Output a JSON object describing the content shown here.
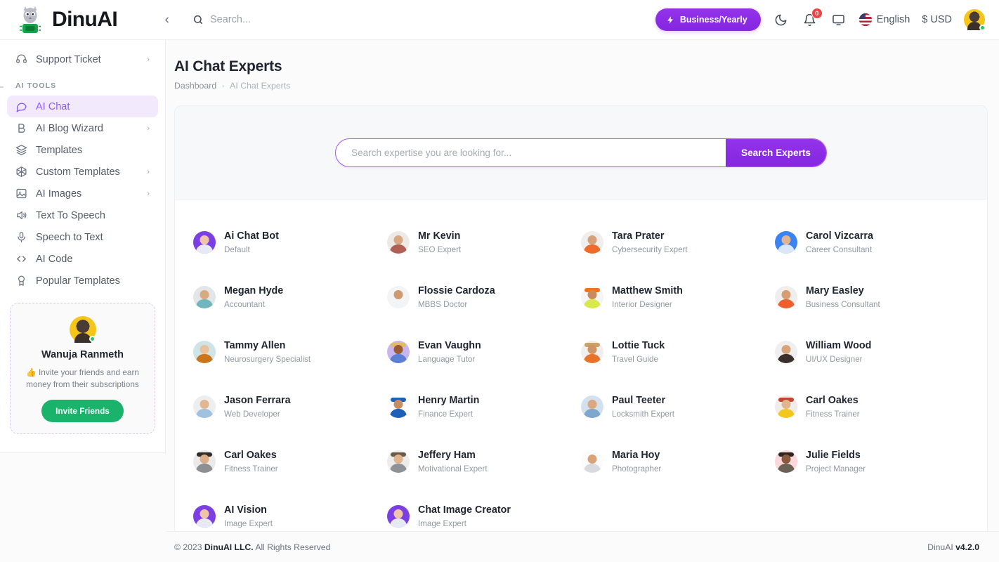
{
  "brand": {
    "name": "DinuAI",
    "logo_icon": "owl-chip-logo"
  },
  "topbar": {
    "collapse_icon": "chevron-left-icon",
    "search_placeholder": "Search...",
    "search_icon": "search-icon",
    "plan_badge": {
      "label": "Business/Yearly",
      "icon": "lightning-bolt-icon",
      "color": "#9333ea"
    },
    "theme_toggle_icon": "moon-icon",
    "notifications": {
      "icon": "bell-icon",
      "count": "0",
      "badge_color": "#ef4444"
    },
    "screen_icon": "monitor-icon",
    "language": {
      "label": "English",
      "flag_icon": "us-flag-icon"
    },
    "currency": {
      "label": "$ USD"
    },
    "avatar": {
      "name": "user-avatar",
      "status": "online",
      "status_color": "#22c55e"
    }
  },
  "sidebar": {
    "top_items": [
      {
        "label": "Support Ticket",
        "icon": "support-ticket-icon",
        "chevron": true,
        "active": false
      }
    ],
    "section_label": "AI TOOLS",
    "items": [
      {
        "label": "AI Chat",
        "icon": "chat-bubble-icon",
        "chevron": false,
        "active": true
      },
      {
        "label": "AI Blog Wizard",
        "icon": "blog-b-icon",
        "chevron": true,
        "active": false
      },
      {
        "label": "Templates",
        "icon": "layers-icon",
        "chevron": false,
        "active": false
      },
      {
        "label": "Custom Templates",
        "icon": "cube-icon",
        "chevron": true,
        "active": false
      },
      {
        "label": "AI Images",
        "icon": "image-icon",
        "chevron": true,
        "active": false
      },
      {
        "label": "Text To Speech",
        "icon": "speaker-icon",
        "chevron": false,
        "active": false
      },
      {
        "label": "Speech to Text",
        "icon": "microphone-icon",
        "chevron": false,
        "active": false
      },
      {
        "label": "AI Code",
        "icon": "code-brackets-icon",
        "chevron": false,
        "active": false
      },
      {
        "label": "Popular Templates",
        "icon": "award-icon",
        "chevron": false,
        "active": false
      }
    ],
    "invite_card": {
      "name": "Wanuja Ranmeth",
      "description": "👍 Invite your friends and earn money from their subscriptions",
      "button_label": "Invite Friends",
      "button_color": "#19b36b",
      "avatar_icon": "user-avatar"
    }
  },
  "page": {
    "title": "AI Chat Experts",
    "breadcrumb": {
      "root": "Dashboard",
      "separator": "›",
      "current": "AI Chat Experts"
    }
  },
  "search": {
    "placeholder": "Search expertise you are looking for...",
    "value": "",
    "button_label": "Search Experts",
    "accent_color": "#a855f7"
  },
  "experts": [
    {
      "name": "Ai Chat Bot",
      "role": "Default",
      "bg": "#7b3fe4",
      "head": "#f0c4a8",
      "torso": "#e7eaf5",
      "hat": ""
    },
    {
      "name": "Mr Kevin",
      "role": "SEO Expert",
      "bg": "#ece9e6",
      "head": "#d8a882",
      "torso": "#b05f54",
      "hat": ""
    },
    {
      "name": "Tara Prater",
      "role": "Cybersecurity Expert",
      "bg": "#f0eeec",
      "head": "#d6a07a",
      "torso": "#ef6b2a",
      "hat": ""
    },
    {
      "name": "Carol Vizcarra",
      "role": "Career Consultant",
      "bg": "#3b82f6",
      "head": "#e0b48e",
      "torso": "#dbe7f7",
      "hat": ""
    },
    {
      "name": "Megan Hyde",
      "role": "Accountant",
      "bg": "#e3e6e8",
      "head": "#d9a97f",
      "torso": "#6fb7bd",
      "hat": ""
    },
    {
      "name": "Flossie Cardoza",
      "role": "MBBS Doctor",
      "bg": "#f4f4f5",
      "head": "#cf9a70",
      "torso": "#f2f4f7",
      "hat": ""
    },
    {
      "name": "Matthew Smith",
      "role": "Interior Designer",
      "bg": "#f5f5f5",
      "head": "#c98a5c",
      "torso": "#d9e84a",
      "hat": "#f97316"
    },
    {
      "name": "Mary Easley",
      "role": "Business Consultant",
      "bg": "#f0eeed",
      "head": "#d79c6f",
      "torso": "#ef5f2b",
      "hat": ""
    },
    {
      "name": "Tammy Allen",
      "role": "Neurosurgery Specialist",
      "bg": "#cfe4e7",
      "head": "#e8c19b",
      "torso": "#c8751c",
      "hat": ""
    },
    {
      "name": "Evan Vaughn",
      "role": "Language Tutor",
      "bg": "#c9b6f0",
      "head": "#9c5a32",
      "torso": "#5b7fd4",
      "hat": "#e0bb6a"
    },
    {
      "name": "Lottie Tuck",
      "role": "Travel Guide",
      "bg": "#f1efee",
      "head": "#cf9365",
      "torso": "#e7722a",
      "hat": "#caa36a"
    },
    {
      "name": "William Wood",
      "role": "UI/UX Designer",
      "bg": "#efefef",
      "head": "#d7a47c",
      "torso": "#3a2f2b",
      "hat": ""
    },
    {
      "name": "Jason Ferrara",
      "role": "Web Developer",
      "bg": "#eceef0",
      "head": "#e3b791",
      "torso": "#9fc2e0",
      "hat": ""
    },
    {
      "name": "Henry Martin",
      "role": "Finance Expert",
      "bg": "#fcfcfc",
      "head": "#c58f62",
      "torso": "#1f5fba",
      "hat": "#1f5fba"
    },
    {
      "name": "Paul Teeter",
      "role": "Locksmith Expert",
      "bg": "#d3e1ef",
      "head": "#dba87d",
      "torso": "#7fa6cd",
      "hat": ""
    },
    {
      "name": "Carl Oakes",
      "role": "Fitness Trainer",
      "bg": "#efecea",
      "head": "#e0b48e",
      "torso": "#f2c81e",
      "hat": "#c4452e"
    },
    {
      "name": "Carl Oakes",
      "role": "Fitness Trainer",
      "bg": "#eceae9",
      "head": "#dcae87",
      "torso": "#8d8f93",
      "hat": "#2f2b28"
    },
    {
      "name": "Jeffery Ham",
      "role": "Motivational Expert",
      "bg": "#eeecea",
      "head": "#e0b48e",
      "torso": "#8e9196",
      "hat": "#6b5a47"
    },
    {
      "name": "Maria Hoy",
      "role": "Photographer",
      "bg": "#fbfbfb",
      "head": "#d8a27a",
      "torso": "#d8dade",
      "hat": ""
    },
    {
      "name": "Julie Fields",
      "role": "Project Manager",
      "bg": "#f9d7da",
      "head": "#8a5a40",
      "torso": "#6b6257",
      "hat": "#2c2420"
    },
    {
      "name": "AI Vision",
      "role": "Image Expert",
      "bg": "#7b3fe4",
      "head": "#f0c4a8",
      "torso": "#e7eaf5",
      "hat": ""
    },
    {
      "name": "Chat Image Creator",
      "role": "Image Expert",
      "bg": "#7b3fe4",
      "head": "#f0c4a8",
      "torso": "#e7eaf5",
      "hat": ""
    }
  ],
  "footer": {
    "copyright_prefix": "© 2023 ",
    "copyright_brand": "DinuAI LLC.",
    "copyright_suffix": " All Rights Reserved",
    "version_label": "DinuAI ",
    "version": "v4.2.0"
  }
}
